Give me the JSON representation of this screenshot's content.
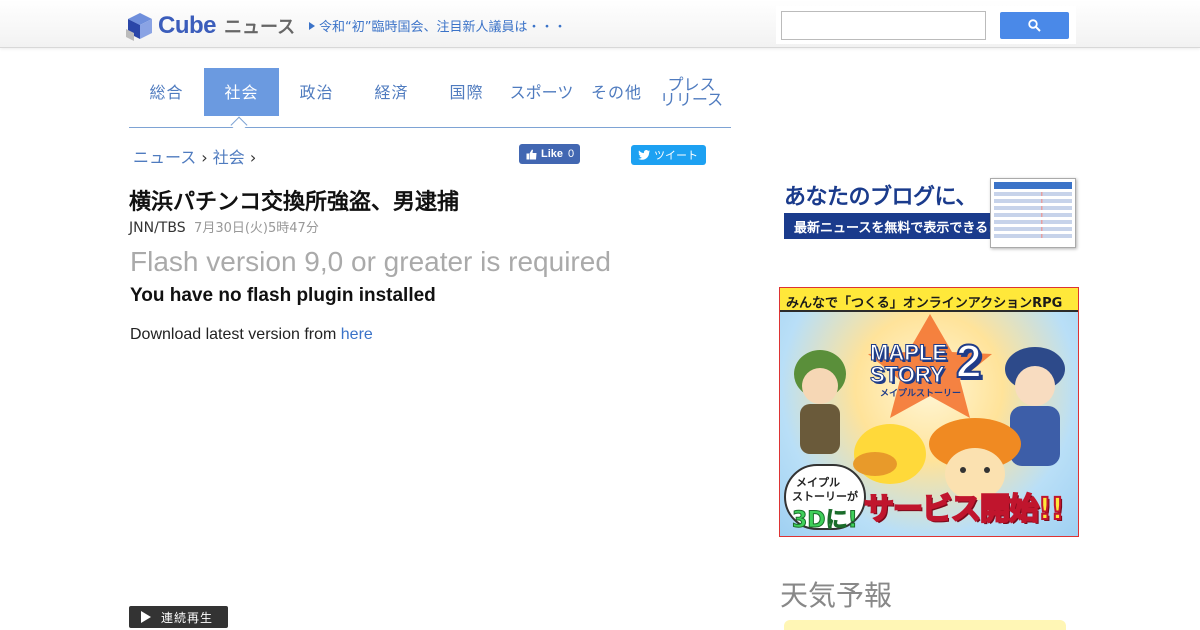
{
  "header": {
    "logo_text": "Cube",
    "logo_sub": "ニュース",
    "ticker": "令和“初”臨時国会、注目新人議員は・・・",
    "search_placeholder": ""
  },
  "tabs": [
    {
      "label": "総合",
      "active": false
    },
    {
      "label": "社会",
      "active": true
    },
    {
      "label": "政治",
      "active": false
    },
    {
      "label": "経済",
      "active": false
    },
    {
      "label": "国際",
      "active": false
    },
    {
      "label": "スポーツ",
      "active": false
    },
    {
      "label": "その他",
      "active": false
    },
    {
      "label_line1": "プレス",
      "label_line2": "リリース",
      "active": false
    }
  ],
  "breadcrumb": {
    "home": "ニュース",
    "sep1": "›",
    "section": "社会",
    "sep2": "›"
  },
  "social": {
    "like_label": "Like",
    "like_count": "0",
    "tweet_label": "ツイート"
  },
  "article": {
    "headline": "横浜パチンコ交換所強盗、男逮捕",
    "source": "JNN/TBS",
    "date": "7月30日(火)5時47分",
    "flash_title": "Flash version 9,0 or greater is required",
    "flash_sub": "You have no flash plugin installed",
    "flash_dl_prefix": "Download latest version from ",
    "flash_dl_link": "here",
    "continuous_play": "連続再生"
  },
  "sidebar": {
    "blog_ad_line1": "あなたのブログに、",
    "blog_ad_line2": "最新ニュースを無料で表示できる!",
    "game_ad_top": "みんなで「つくる」オンラインアクションRPG",
    "game_logo_1": "MAPLE",
    "game_logo_2": "STORY",
    "game_logo_num": "2",
    "game_logo_sub": "メイプルストーリー",
    "game_bubble_1": "メイプル",
    "game_bubble_2": "ストーリーが",
    "game_bubble_3": "3Dに!",
    "game_cta": "サービス開始!!",
    "weather_title": "天気予報"
  },
  "colors": {
    "accent": "#6b9ae0",
    "link": "#4f7bbf",
    "facebook": "#4267b2",
    "twitter": "#1da1f2"
  }
}
